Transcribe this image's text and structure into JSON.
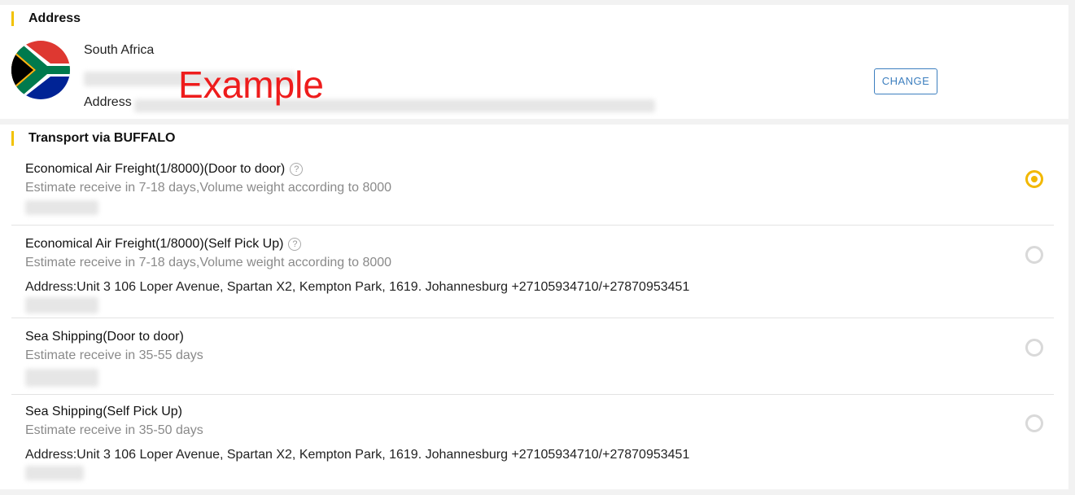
{
  "address": {
    "title": "Address",
    "country": "South Africa",
    "address_label": "Address",
    "change_label": "CHANGE",
    "watermark": "Example"
  },
  "transport": {
    "title": "Transport via BUFFALO",
    "options": [
      {
        "title": "Economical Air Freight(1/8000)(Door to door)",
        "has_help": true,
        "estimate": "Estimate receive in 7-18 days,Volume weight according to 8000",
        "address": "",
        "selected": true
      },
      {
        "title": "Economical Air Freight(1/8000)(Self Pick Up)",
        "has_help": true,
        "estimate": "Estimate receive in 7-18 days,Volume weight according to 8000",
        "address": "Address:Unit 3 106 Loper Avenue, Spartan X2, Kempton Park, 1619. Johannesburg +27105934710/+27870953451",
        "selected": false
      },
      {
        "title": "Sea Shipping(Door to door)",
        "has_help": false,
        "estimate": "Estimate receive in 35-55 days",
        "address": "",
        "selected": false
      },
      {
        "title": "Sea Shipping(Self Pick Up)",
        "has_help": false,
        "estimate": "Estimate receive in 35-50 days",
        "address": "Address:Unit 3 106 Loper Avenue, Spartan X2, Kempton Park, 1619. Johannesburg +27105934710/+27870953451",
        "selected": false
      }
    ]
  },
  "colors": {
    "accent": "#f2b800",
    "link_blue": "#3d7fbf",
    "watermark_red": "#ee1c1c"
  },
  "icons": {
    "flag": "south-africa-flag-icon",
    "help": "question-circle-icon",
    "radio": "radio-icon"
  }
}
